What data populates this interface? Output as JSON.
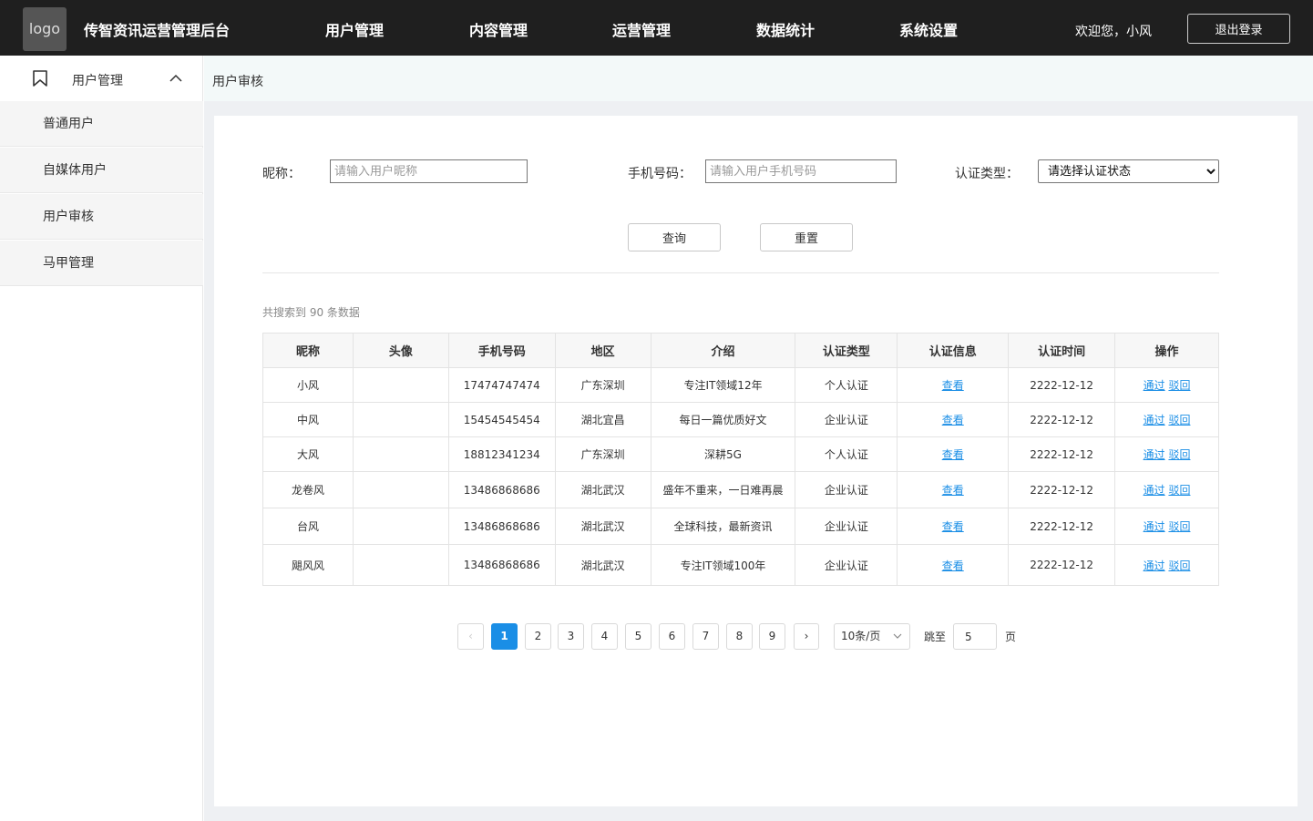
{
  "header": {
    "logo_text": "logo",
    "app_title": "传智资讯运营管理后台",
    "nav": [
      "用户管理",
      "内容管理",
      "运营管理",
      "数据统计",
      "系统设置"
    ],
    "welcome": "欢迎您，小风",
    "logout_label": "退出登录"
  },
  "sidebar": {
    "group_label": "用户管理",
    "items": [
      "普通用户",
      "自媒体用户",
      "用户审核",
      "马甲管理"
    ]
  },
  "breadcrumb": "用户审核",
  "filters": {
    "nickname_label": "昵称：",
    "nickname_placeholder": "请输入用户昵称",
    "phone_label": "手机号码：",
    "phone_placeholder": "请输入用户手机号码",
    "auth_type_label": "认证类型：",
    "auth_type_selected": "请选择认证状态",
    "search_label": "查询",
    "reset_label": "重置"
  },
  "result_count": "共搜索到 90 条数据",
  "table": {
    "columns": [
      "昵称",
      "头像",
      "手机号码",
      "地区",
      "介绍",
      "认证类型",
      "认证信息",
      "认证时间",
      "操作"
    ],
    "rows": [
      {
        "nickname": "小风",
        "phone": "17474747474",
        "region": "广东深圳",
        "intro": "专注IT领域12年",
        "auth_type": "个人认证",
        "info": "查看",
        "time": "2222-12-12",
        "approve": "通过",
        "reject": "驳回"
      },
      {
        "nickname": "中风",
        "phone": "15454545454",
        "region": "湖北宜昌",
        "intro": "每日一篇优质好文",
        "auth_type": "企业认证",
        "info": "查看",
        "time": "2222-12-12",
        "approve": "通过",
        "reject": "驳回"
      },
      {
        "nickname": "大风",
        "phone": "18812341234",
        "region": "广东深圳",
        "intro": "深耕5G",
        "auth_type": "个人认证",
        "info": "查看",
        "time": "2222-12-12",
        "approve": "通过",
        "reject": "驳回"
      },
      {
        "nickname": "龙卷风",
        "phone": "13486868686",
        "region": "湖北武汉",
        "intro": "盛年不重来，一日难再晨",
        "auth_type": "企业认证",
        "info": "查看",
        "time": "2222-12-12",
        "approve": "通过",
        "reject": "驳回"
      },
      {
        "nickname": "台风",
        "phone": "13486868686",
        "region": "湖北武汉",
        "intro": "全球科技，最新资讯",
        "auth_type": "企业认证",
        "info": "查看",
        "time": "2222-12-12",
        "approve": "通过",
        "reject": "驳回"
      },
      {
        "nickname": "飓风风",
        "phone": "13486868686",
        "region": "湖北武汉",
        "intro": "专注IT领域100年",
        "auth_type": "企业认证",
        "info": "查看",
        "time": "2222-12-12",
        "approve": "通过",
        "reject": "驳回"
      }
    ]
  },
  "pagination": {
    "prev": "‹",
    "pages": [
      "1",
      "2",
      "3",
      "4",
      "5",
      "6",
      "7",
      "8",
      "9"
    ],
    "current": "1",
    "next": "›",
    "page_size": "10条/页",
    "jump_label": "跳至",
    "jump_value": "5",
    "page_suffix": "页"
  },
  "colors": {
    "accent": "#1a8ee6",
    "topbar": "#1f1f1f"
  }
}
